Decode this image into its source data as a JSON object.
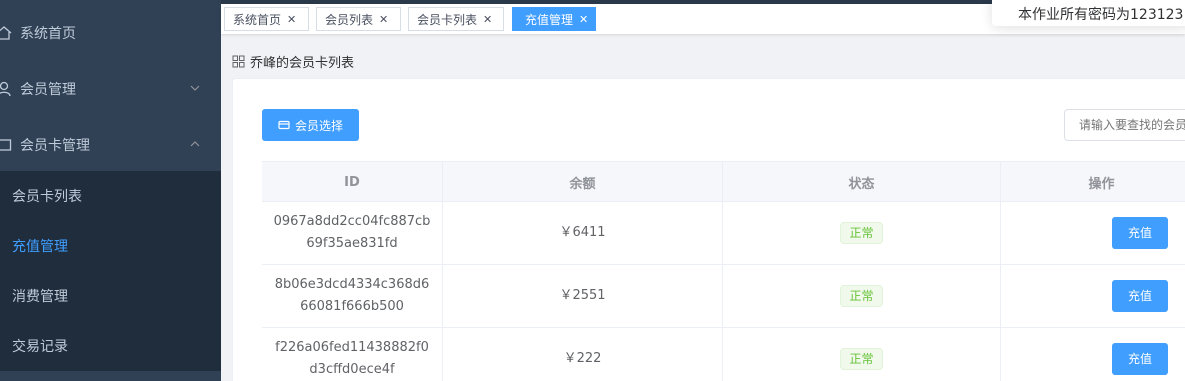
{
  "sidebar": {
    "items": [
      {
        "label": "系统首页",
        "icon": "home-icon"
      },
      {
        "label": "会员管理",
        "icon": "user-icon",
        "chevron": "down"
      },
      {
        "label": "会员卡管理",
        "icon": "card-icon",
        "chevron": "up"
      }
    ],
    "subitems": [
      {
        "label": "会员卡列表",
        "active": false
      },
      {
        "label": "充值管理",
        "active": true
      },
      {
        "label": "消费管理",
        "active": false
      },
      {
        "label": "交易记录",
        "active": false
      }
    ]
  },
  "tabs": [
    {
      "label": "系统首页",
      "close": "✕",
      "active": false
    },
    {
      "label": "会员列表",
      "close": "✕",
      "active": false
    },
    {
      "label": "会员卡列表",
      "close": "✕",
      "active": false
    },
    {
      "label": "充值管理",
      "close": "✕",
      "active": true
    }
  ],
  "notice": {
    "text": "本作业所有密码为123123"
  },
  "breadcrumb": {
    "title": "乔峰的会员卡列表"
  },
  "toolbar": {
    "select_member_label": "会员选择",
    "search_placeholder": "请输入要查找的会员卡ID"
  },
  "table": {
    "headers": [
      "ID",
      "余额",
      "状态",
      "操作"
    ],
    "rows": [
      {
        "id": "0967a8dd2cc04fc887cb69f35ae831fd",
        "balance": "￥6411",
        "status": "正常",
        "action": "充值"
      },
      {
        "id": "8b06e3dcd4334c368d666081f666b500",
        "balance": "￥2551",
        "status": "正常",
        "action": "充值"
      },
      {
        "id": "f226a06fed11438882f0d3cffd0ece4f",
        "balance": "￥222",
        "status": "正常",
        "action": "充值"
      }
    ]
  },
  "colors": {
    "sidebar_bg": "#304156",
    "submenu_bg": "#1f2d3d",
    "primary": "#409eff",
    "success": "#67c23a"
  }
}
